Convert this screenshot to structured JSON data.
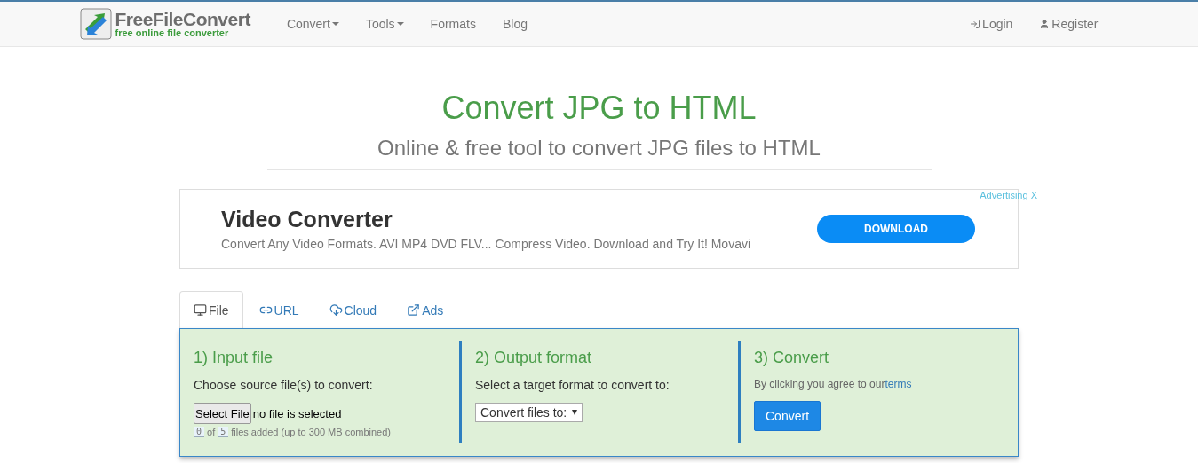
{
  "logo": {
    "name": "FreeFileConvert",
    "tagline": "free online file converter"
  },
  "nav": [
    {
      "label": "Convert",
      "kind": "dropdown"
    },
    {
      "label": "Tools",
      "kind": "dropdown"
    },
    {
      "label": "Formats",
      "kind": "link"
    },
    {
      "label": "Blog",
      "kind": "link"
    }
  ],
  "account": [
    {
      "label": "Login",
      "kind": "login"
    },
    {
      "label": "Register",
      "kind": "register"
    }
  ],
  "heading": "Convert JPG to HTML",
  "subheading": "Online & free tool to convert JPG files to HTML",
  "ad": {
    "label": "Advertising X",
    "title": "Video Converter",
    "text": "Convert Any Video Formats. AVI MP4 DVD FLV... Compress Video. Download and Try It! Movavi",
    "button": "DOWNLOAD"
  },
  "tabs": [
    {
      "label": "File",
      "kind": "file",
      "selected": true
    },
    {
      "label": "URL",
      "kind": "url",
      "selected": false
    },
    {
      "label": "Cloud",
      "kind": "cloud",
      "selected": false
    },
    {
      "label": "Ads",
      "kind": "ads",
      "selected": false
    }
  ],
  "steps": {
    "input": {
      "title": "1) Input file",
      "text": "Choose source file(s) to convert:",
      "button": "Select File",
      "status": "no file is selected",
      "count": "0",
      "of": "of",
      "max": "5",
      "note": "files added (up to 300 MB combined)"
    },
    "output": {
      "title": "2) Output format",
      "text": "Select a target format to convert to:",
      "select": "Convert files to:"
    },
    "convert": {
      "title": "3) Convert",
      "text": "By clicking you agree to our",
      "link": "terms",
      "button": "Convert"
    }
  }
}
